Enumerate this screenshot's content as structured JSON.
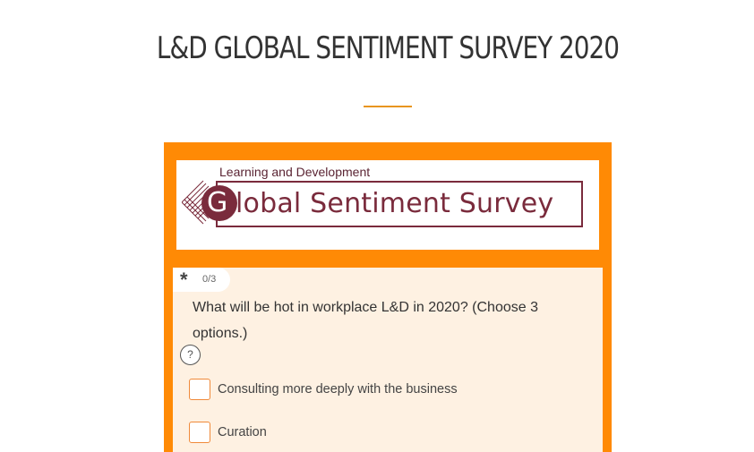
{
  "page": {
    "title": "L&D GLOBAL SENTIMENT SURVEY 2020"
  },
  "banner": {
    "subtitle": "Learning and Development",
    "logo_letter": "G",
    "title": "lobal Sentiment Survey",
    "colors": {
      "brand": "#7a2b3c",
      "frame": "#ff8a05"
    }
  },
  "question": {
    "required_icon": "asterisk-icon",
    "required_mark": "*",
    "counter": "0/3",
    "text": "What will be hot in workplace L&D in 2020? (Choose 3 options.)",
    "help_label": "?",
    "options": [
      {
        "label": "Consulting more deeply with the business",
        "checked": false
      },
      {
        "label": "Curation",
        "checked": false
      }
    ]
  }
}
